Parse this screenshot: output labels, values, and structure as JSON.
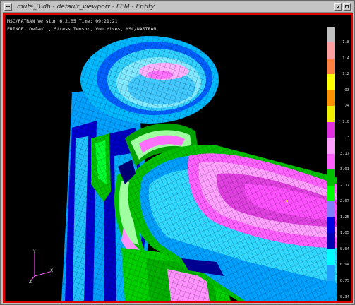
{
  "window": {
    "title": "mufe_3.db - default_viewport - FEM - Entity"
  },
  "viewport": {
    "header_line1": "MSC/PATRAN Version 6.2.05  Time: 09:21:21",
    "header_line2": "FRINGE: Default, Stress Tensor, Von Mises, MSC/NASTRAN"
  },
  "legend": {
    "colors": [
      "#c0c0c0",
      "#ffa0a0",
      "#ff8040",
      "#ffff00",
      "#ff9000",
      "#f0f000",
      "#e030e0",
      "#ffa0ff",
      "#ff60ff",
      "#00c000",
      "#00ff00",
      "#8080ff",
      "#0000e0",
      "#0000b0",
      "#00ffff",
      "#20a0ff",
      "#00a0ff"
    ],
    "ticks": [
      "1.8",
      "1.4",
      "1.2",
      "93",
      "74",
      "1.0",
      "3",
      "3.17",
      "3.01",
      "2.17",
      "2.07",
      "1.25",
      "1.05",
      "0.64",
      "0.94",
      "0.75"
    ],
    "bottom_value": "0.34"
  },
  "triad": {
    "y_label": "Y",
    "x_label": "X",
    "z_label": "Z"
  },
  "highlight_marker": "S"
}
